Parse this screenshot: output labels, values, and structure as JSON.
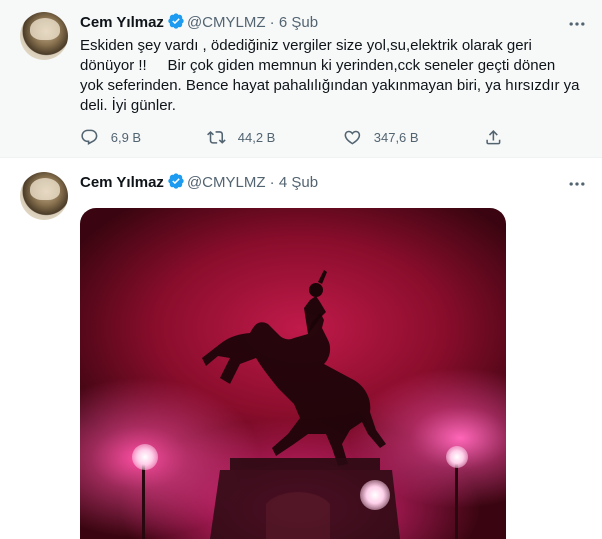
{
  "tweets": [
    {
      "author": {
        "name": "Cem Yılmaz",
        "handle": "@CMYLMZ",
        "separator": "·",
        "date": "6 Şub"
      },
      "text": "Eskiden şey vardı , ödediğiniz vergiler size yol,su,elektrik olarak geri dönüyor !!     Bir çok giden memnun ki yerinden,cck seneler geçti dönen yok seferinden. Bence hayat pahalılığından yakınmayan biri, ya hırsızdır ya deli. İyi günler.",
      "actions": {
        "replies": "6,9 B",
        "retweets": "44,2 B",
        "likes": "347,6 B"
      }
    },
    {
      "author": {
        "name": "Cem Yılmaz",
        "handle": "@CMYLMZ",
        "separator": "·",
        "date": "4 Şub"
      }
    }
  ],
  "icons": {
    "more": "more-horizontal-icon",
    "verified": "verified-badge-icon",
    "reply": "reply-icon",
    "retweet": "retweet-icon",
    "like": "heart-icon",
    "share": "share-icon"
  },
  "colors": {
    "verified_blue": "#1d9bf0",
    "secondary_text": "#536471",
    "hover_background": "#f7f9f9"
  }
}
